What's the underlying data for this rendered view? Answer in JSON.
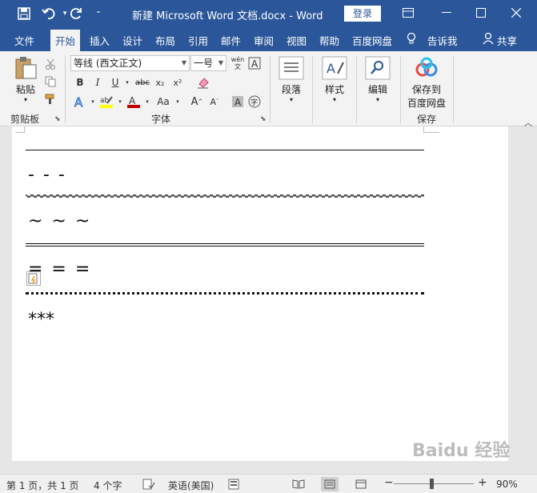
{
  "window": {
    "title": "新建 Microsoft Word 文档.docx  -  Word",
    "login_label": "登录"
  },
  "tabs": [
    {
      "label": "文件"
    },
    {
      "label": "开始"
    },
    {
      "label": "插入"
    },
    {
      "label": "设计"
    },
    {
      "label": "布局"
    },
    {
      "label": "引用"
    },
    {
      "label": "邮件"
    },
    {
      "label": "审阅"
    },
    {
      "label": "视图"
    },
    {
      "label": "帮助"
    },
    {
      "label": "百度网盘"
    },
    {
      "label": "告诉我"
    },
    {
      "label": "共享"
    }
  ],
  "ribbon": {
    "clipboard": {
      "paste_label": "粘贴",
      "group_label": "剪贴板"
    },
    "font": {
      "font_name": "等线 (西文正文)",
      "font_size": "一号",
      "group_label": "字体",
      "bold": "B",
      "italic": "I",
      "underline": "U",
      "strike": "abc",
      "subscript": "x₂",
      "superscript": "x²",
      "grow": "A",
      "shrink": "A",
      "case": "Aa",
      "phonetic": "wén文"
    },
    "paragraph": {
      "label": "段落"
    },
    "styles": {
      "label": "样式"
    },
    "editing": {
      "label": "编辑"
    },
    "save": {
      "label_line1": "保存到",
      "label_line2": "百度网盘",
      "group_label": "保存"
    }
  },
  "document": {
    "lines": [
      "- - -",
      "~ ~ ~",
      "= = =",
      "***"
    ]
  },
  "statusbar": {
    "page": "第 1 页，共 1 页",
    "words": "4 个字",
    "language": "英语(美国)",
    "zoom": "90%",
    "zoom_value": 90
  },
  "watermark": "Baidu 经验",
  "colors": {
    "accent": "#2b579a",
    "highlight": "#ffff00",
    "font_color": "#c00000"
  }
}
